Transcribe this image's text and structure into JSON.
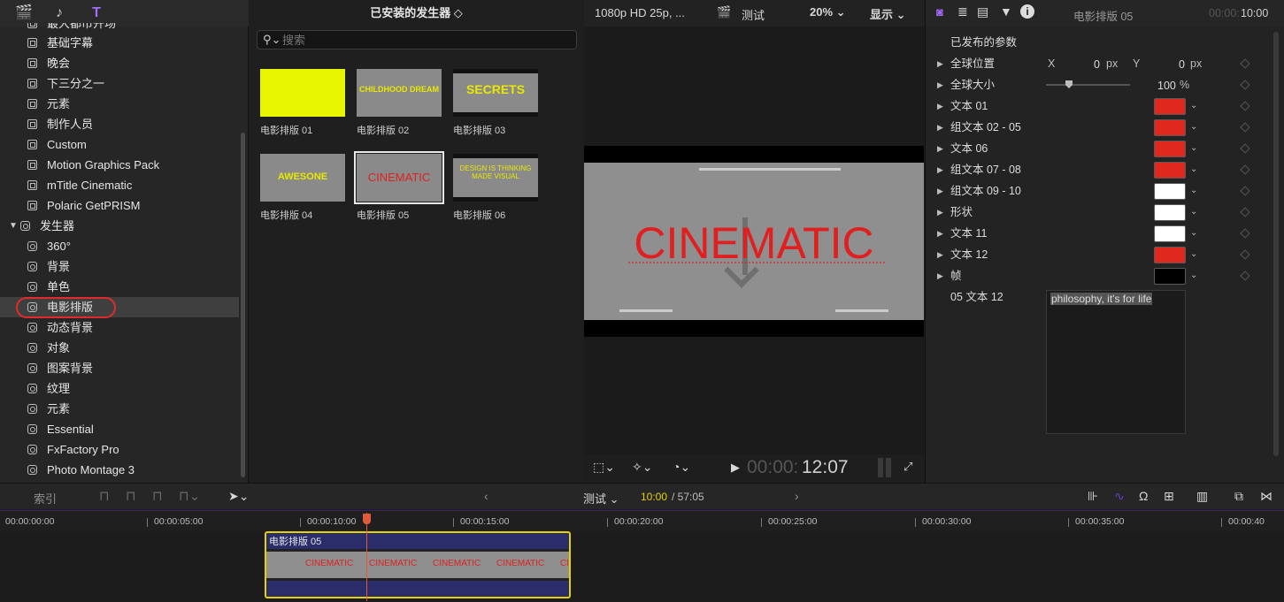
{
  "sidebar": {
    "top_partial_label": "最大都市开场",
    "items": [
      {
        "label": "基础字幕",
        "kind": "title"
      },
      {
        "label": "晚会",
        "kind": "title"
      },
      {
        "label": "下三分之一",
        "kind": "title"
      },
      {
        "label": "元素",
        "kind": "title"
      },
      {
        "label": "制作人员",
        "kind": "title"
      },
      {
        "label": "Custom",
        "kind": "title"
      },
      {
        "label": "Motion Graphics Pack",
        "kind": "title"
      },
      {
        "label": "mTitle Cinematic",
        "kind": "title"
      },
      {
        "label": "Polaric GetPRISM",
        "kind": "title"
      }
    ],
    "section": {
      "label": "发生器",
      "expanded": true
    },
    "generator_items": [
      {
        "label": "360°"
      },
      {
        "label": "背景"
      },
      {
        "label": "单色"
      },
      {
        "label": "电影排版",
        "selected": true
      },
      {
        "label": "动态背景"
      },
      {
        "label": "对象"
      },
      {
        "label": "图案背景"
      },
      {
        "label": "纹理"
      },
      {
        "label": "元素"
      },
      {
        "label": "Essential"
      },
      {
        "label": "FxFactory Pro"
      },
      {
        "label": "Photo Montage 3"
      }
    ]
  },
  "browser": {
    "title": "已安装的发生器 ◇",
    "search_placeholder": "搜索",
    "thumbs": [
      {
        "label": "电影排版 01",
        "text": "",
        "bg": "#e8f500"
      },
      {
        "label": "电影排版 02",
        "text": "CHILDHOOD DREAM",
        "bg": "#8a8a8a"
      },
      {
        "label": "电影排版 03",
        "text": "SECRETS",
        "bg": "#8a8a8a"
      },
      {
        "label": "电影排版 04",
        "text": "AWESONE",
        "bg": "#8a8a8a"
      },
      {
        "label": "电影排版 05",
        "text": "CINEMATIC",
        "bg": "#8a8a8a",
        "selected": true
      },
      {
        "label": "电影排版 06",
        "text": "DESIGN IS THINKING MADE VISUAL",
        "bg": "#8a8a8a"
      }
    ]
  },
  "viewer": {
    "format": "1080p HD 25p, ...",
    "project": "测试",
    "zoom": "20% ⌄",
    "display": "显示 ⌄",
    "frame_text": "CINEMATIC",
    "timecode_dim": "00:00:",
    "timecode": "12:07",
    "colors": {
      "accent_text": "#e02020"
    }
  },
  "inspector": {
    "title": "电影排版 05",
    "timecode_dim": "00:00:",
    "timecode": "10:00",
    "section_header": "已发布的参数",
    "position": {
      "label": "全球位置",
      "x_label": "X",
      "x_value": "0",
      "x_unit": "px",
      "y_label": "Y",
      "y_value": "0",
      "y_unit": "px"
    },
    "scale": {
      "label": "全球大小",
      "value": "100",
      "unit": "%"
    },
    "color_rows": [
      {
        "label": "文本 01",
        "color": "#e0281e"
      },
      {
        "label": "组文本 02 - 05",
        "color": "#e0281e"
      },
      {
        "label": "文本 06",
        "color": "#e0281e"
      },
      {
        "label": "组文本 07 - 08",
        "color": "#e0281e"
      },
      {
        "label": "组文本 09 - 10",
        "color": "#ffffff"
      },
      {
        "label": "形状",
        "color": "#ffffff"
      },
      {
        "label": "文本 11",
        "color": "#ffffff"
      },
      {
        "label": "文本 12",
        "color": "#e0281e"
      },
      {
        "label": "帧",
        "color": "#000000"
      }
    ],
    "text_field": {
      "label": "05 文本 12",
      "value": "philosophy, it's for life"
    }
  },
  "timeline": {
    "index_label": "索引",
    "project": "测试 ⌄",
    "current": "10:00",
    "total": "/ 57:05",
    "ticks": [
      "00:00:00:00",
      "00:00:05:00",
      "00:00:10:00",
      "00:00:15:00",
      "00:00:20:00",
      "00:00:25:00",
      "00:00:30:00",
      "00:00:35:00",
      "00:00:40"
    ],
    "clip": {
      "title": "电影排版 05",
      "word": "CINEMATIC",
      "border": "#e6d200"
    }
  }
}
